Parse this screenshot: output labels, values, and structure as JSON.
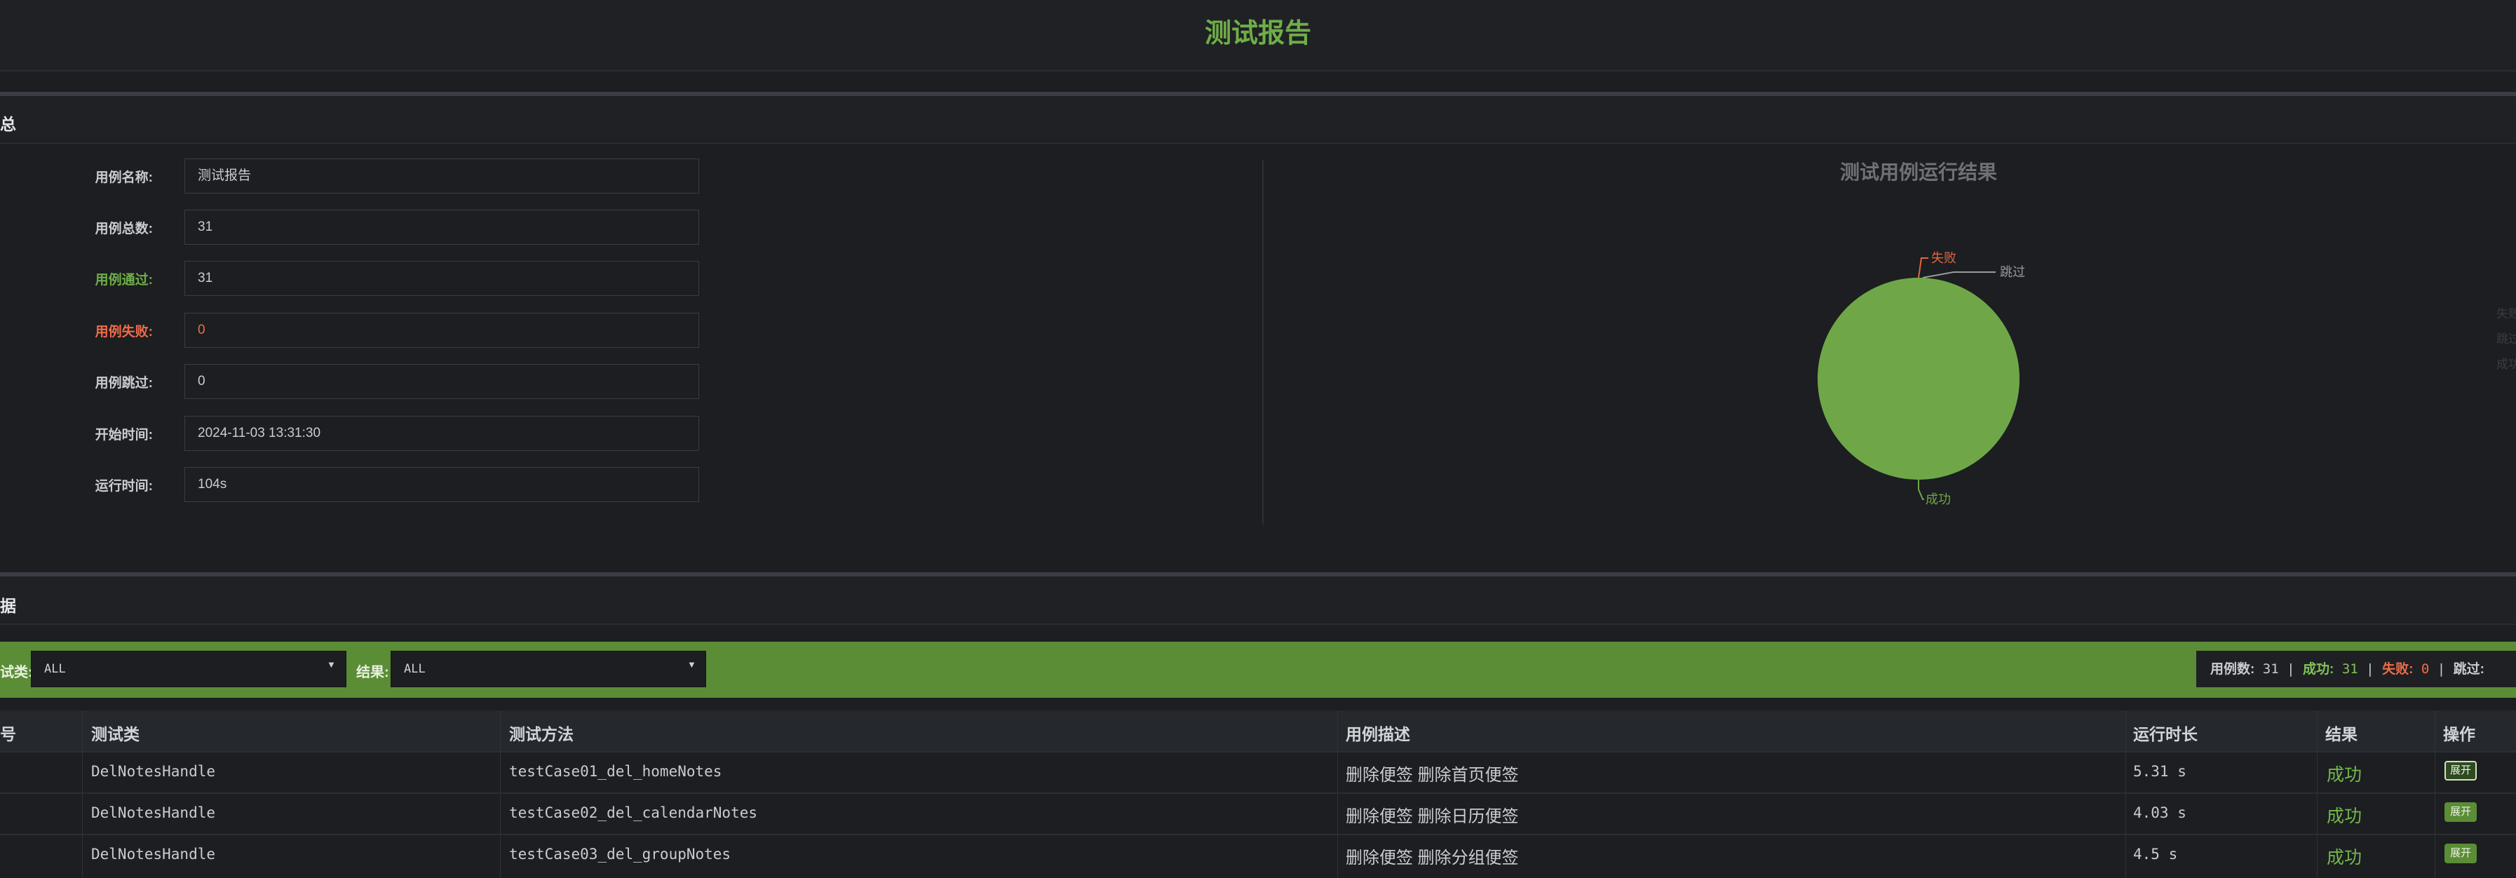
{
  "title": "测试报告",
  "summary": {
    "section_title": "汇总",
    "fields": [
      {
        "label": "用例名称:",
        "value": "测试报告"
      },
      {
        "label": "用例总数:",
        "value": "31"
      },
      {
        "label": "用例通过:",
        "value": "31"
      },
      {
        "label": "用例失败:",
        "value": "0"
      },
      {
        "label": "用例跳过:",
        "value": "0"
      },
      {
        "label": "开始时间:",
        "value": "2024-11-03 13:31:30"
      },
      {
        "label": "运行时间:",
        "value": "104s"
      }
    ],
    "label_colors": {
      "pass": "#6fae48",
      "fail": "#ef6c4a"
    }
  },
  "chart_data": {
    "type": "pie",
    "title": "测试用例运行结果",
    "categories": [
      "成功",
      "失败",
      "跳过"
    ],
    "values": [
      31,
      0,
      0
    ],
    "colors": [
      "#6fa748",
      "#e2673e",
      "#9a9a9a"
    ],
    "legend": {
      "placement": "right",
      "entries": [
        "失败",
        "跳过",
        "成功"
      ]
    }
  },
  "data_section": {
    "section_title": "数据",
    "filters": {
      "class_label": "测试类:",
      "class_value": "ALL",
      "result_label": "结果:",
      "result_value": "ALL"
    },
    "stats": {
      "total_label": "用例数:",
      "total_value": "31",
      "pass_label": "成功:",
      "pass_value": "31",
      "fail_label": "失败:",
      "fail_value": "0",
      "skip_label": "跳过:",
      "sep": "|"
    },
    "columns": [
      "序号",
      "测试类",
      "测试方法",
      "用例描述",
      "运行时长",
      "结果",
      "操作"
    ],
    "rows": [
      {
        "class": "DelNotesHandle",
        "method": "testCase01_del_homeNotes",
        "desc": "删除便签 删除首页便签",
        "duration": "5.31 s",
        "result": "成功",
        "action": "展开"
      },
      {
        "class": "DelNotesHandle",
        "method": "testCase02_del_calendarNotes",
        "desc": "删除便签 删除日历便签",
        "duration": "4.03 s",
        "result": "成功",
        "action": "展开"
      },
      {
        "class": "DelNotesHandle",
        "method": "testCase03_del_groupNotes",
        "desc": "删除便签 删除分组便签",
        "duration": "4.5 s",
        "result": "成功",
        "action": "展开"
      }
    ]
  }
}
